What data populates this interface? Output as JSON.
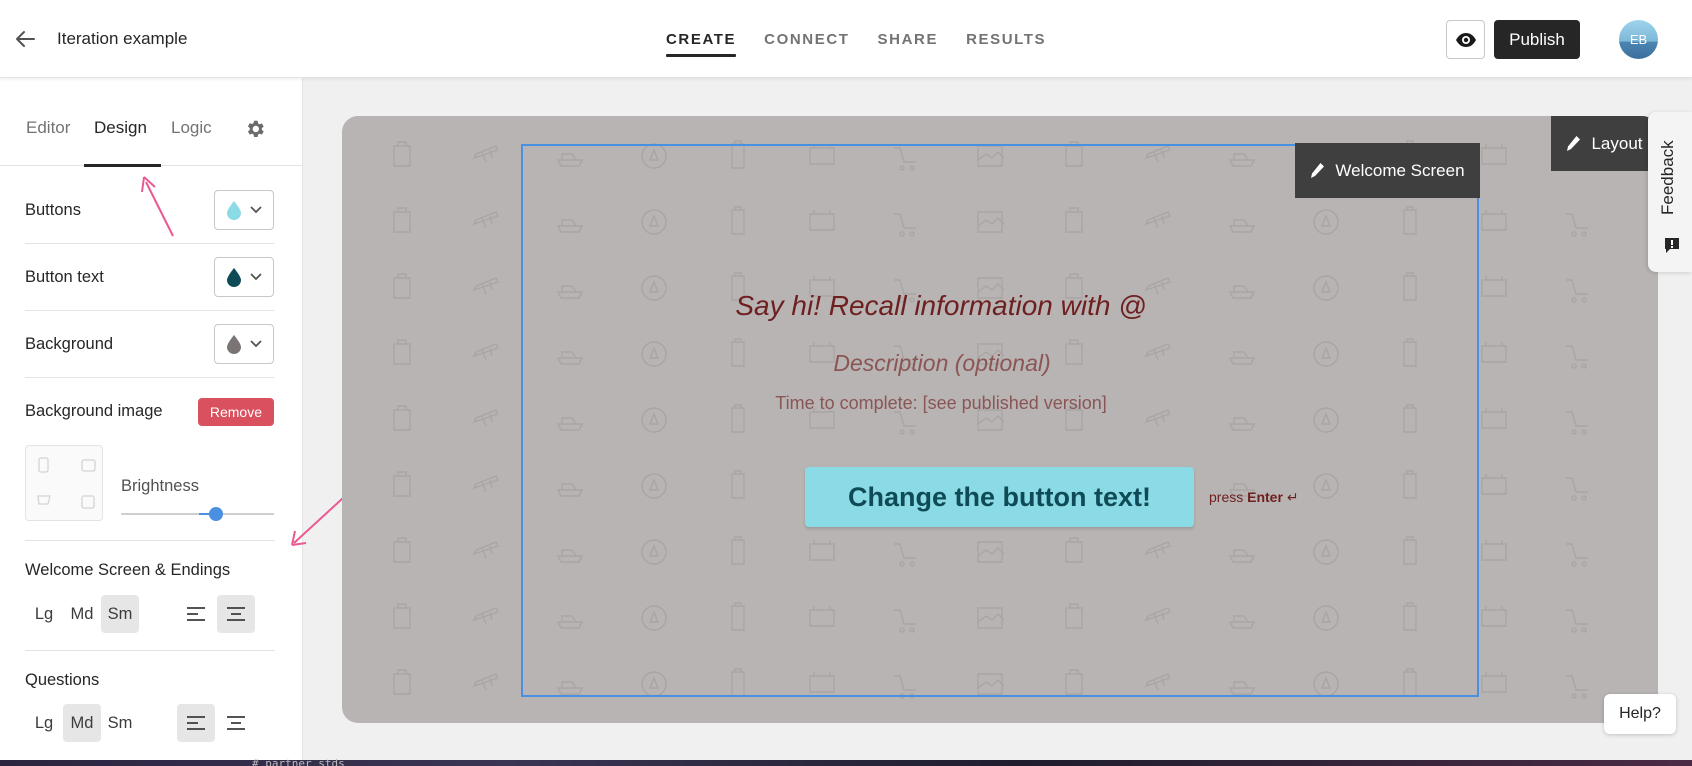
{
  "header": {
    "back_icon": "arrow-left-icon",
    "title": "Iteration example",
    "nav": [
      "CREATE",
      "CONNECT",
      "SHARE",
      "RESULTS"
    ],
    "active_nav": "CREATE",
    "preview_icon": "eye-icon",
    "publish_label": "Publish",
    "avatar_initials": "EB"
  },
  "sidebar": {
    "tabs": [
      "Editor",
      "Design",
      "Logic"
    ],
    "active_tab": "Design",
    "settings_icon": "gear-icon",
    "color_rows": [
      {
        "label": "Buttons",
        "swatch_color": "#8adbe5",
        "icon": "droplet-icon"
      },
      {
        "label": "Button text",
        "swatch_color": "#0f4b56",
        "icon": "droplet-icon"
      },
      {
        "label": "Background",
        "swatch_color": "#7a7474",
        "icon": "droplet-icon"
      }
    ],
    "background_image": {
      "label": "Background image",
      "remove_label": "Remove"
    },
    "brightness": {
      "label": "Brightness",
      "value": 0.62
    },
    "welcome_section": {
      "label": "Welcome Screen & Endings",
      "sizes": [
        "Lg",
        "Md",
        "Sm"
      ],
      "selected_size": "Sm",
      "selected_align": "center"
    },
    "questions_section": {
      "label": "Questions",
      "sizes": [
        "Lg",
        "Md",
        "Sm"
      ],
      "selected_size": "Md",
      "selected_align": "left"
    }
  },
  "canvas": {
    "welcome_badge": "Welcome Screen",
    "layout_badge": "Layout",
    "title": "Say hi! Recall information with @",
    "description": "Description (optional)",
    "time_to_complete": "Time to complete: [see published version]",
    "button_text": "Change the button text!",
    "press_hint_prefix": "press",
    "press_hint_key": "Enter",
    "background_color": "#b8b4b3",
    "title_color": "#6e1f1f"
  },
  "feedback_label": "Feedback",
  "help_label": "Help?",
  "bottom_text": "#  partner_stds"
}
